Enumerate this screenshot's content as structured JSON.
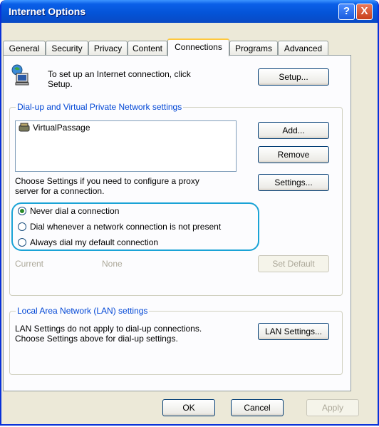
{
  "window": {
    "title": "Internet Options"
  },
  "titlebar": {
    "help_label": "?",
    "close_label": "X"
  },
  "tabs": [
    {
      "label": "General"
    },
    {
      "label": "Security"
    },
    {
      "label": "Privacy"
    },
    {
      "label": "Content"
    },
    {
      "label": "Connections"
    },
    {
      "label": "Programs"
    },
    {
      "label": "Advanced"
    }
  ],
  "setup": {
    "text_line1": "To set up an Internet connection, click",
    "text_line2": "Setup.",
    "button_label": "Setup..."
  },
  "dialup": {
    "group_label": "Dial-up and Virtual Private Network settings",
    "connections": [
      "VirtualPassage"
    ],
    "add_label": "Add...",
    "remove_label": "Remove",
    "proxy_text_line1": "Choose Settings if you need to configure a proxy",
    "proxy_text_line2": "server for a connection.",
    "settings_label": "Settings...",
    "options": [
      {
        "label": "Never dial a connection",
        "selected": true
      },
      {
        "label": "Dial whenever a network connection is not present",
        "selected": false
      },
      {
        "label": "Always dial my default connection",
        "selected": false
      }
    ],
    "current_label": "Current",
    "current_value": "None",
    "set_default_label": "Set Default"
  },
  "lan": {
    "group_label": "Local Area Network (LAN) settings",
    "text_line1": "LAN Settings do not apply to dial-up connections.",
    "text_line2": "Choose Settings above for dial-up settings.",
    "button_label": "LAN Settings..."
  },
  "footer": {
    "ok_label": "OK",
    "cancel_label": "Cancel",
    "apply_label": "Apply"
  },
  "colors": {
    "titlebar": "#0453d6",
    "dialog_bg": "#ece9d8",
    "tab_page_bg": "#fcfcfe",
    "group_label": "#0046d5",
    "annotation_highlight": "#1aa3d6"
  }
}
